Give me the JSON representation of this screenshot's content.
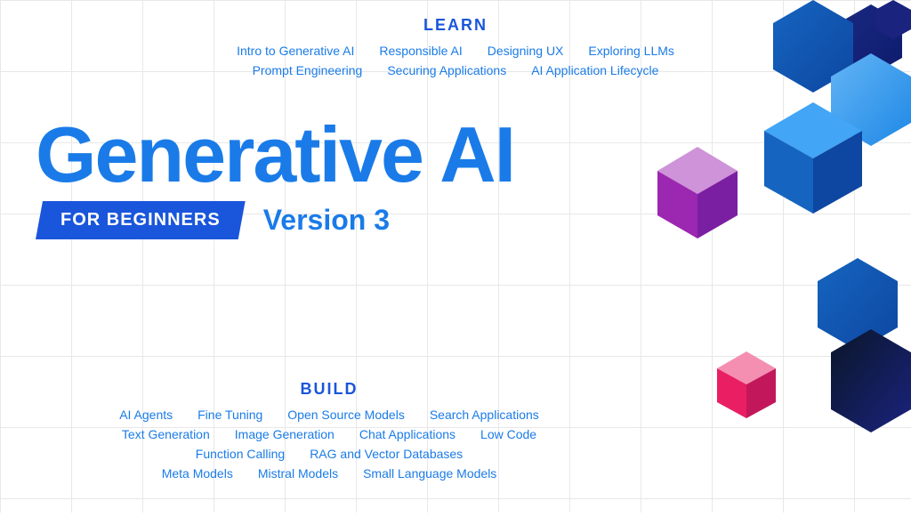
{
  "learn": {
    "title": "LEARN",
    "row1": [
      "Intro to Generative AI",
      "Responsible AI",
      "Designing UX",
      "Exploring LLMs"
    ],
    "row2": [
      "Prompt Engineering",
      "Securing Applications",
      "AI Application Lifecycle"
    ]
  },
  "main": {
    "title": "Generative AI",
    "badge": "FOR BEGINNERS",
    "version": "Version 3"
  },
  "build": {
    "title": "BUILD",
    "row1": [
      "AI Agents",
      "Fine Tuning",
      "Open Source Models",
      "Search Applications"
    ],
    "row2": [
      "Text Generation",
      "Image Generation",
      "Chat Applications",
      "Low Code"
    ],
    "row3": [
      "Function Calling",
      "RAG and Vector Databases"
    ],
    "row4": [
      "Meta Models",
      "Mistral Models",
      "Small Language Models"
    ]
  }
}
